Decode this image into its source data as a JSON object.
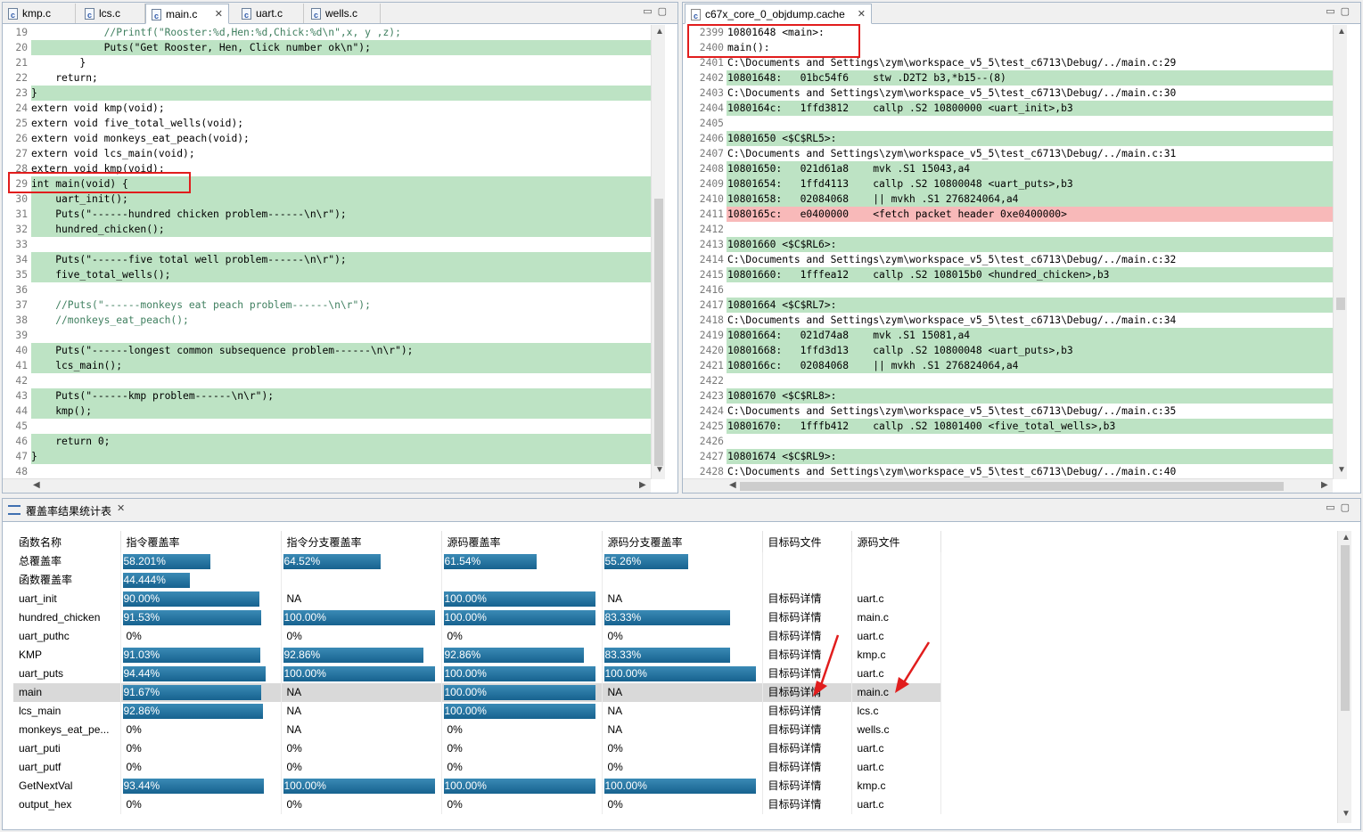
{
  "left_editor": {
    "tabs": [
      "kmp.c",
      "lcs.c",
      "main.c",
      "uart.c",
      "wells.c"
    ],
    "active_tab": "main.c",
    "lines": [
      {
        "n": "19",
        "t": "            //Printf(\"Rooster:%d,Hen:%d,Chick:%d\\n\",x, y ,z);",
        "hl": "none"
      },
      {
        "n": "20",
        "t": "            Puts(\"Get Rooster, Hen, Click number ok\\n\");",
        "hl": "green"
      },
      {
        "n": "21",
        "t": "        }",
        "hl": "none"
      },
      {
        "n": "22",
        "t": "    return;",
        "hl": "none"
      },
      {
        "n": "23",
        "t": "}",
        "hl": "green"
      },
      {
        "n": "24",
        "t": "extern void kmp(void);",
        "hl": "none"
      },
      {
        "n": "25",
        "t": "extern void five_total_wells(void);",
        "hl": "none"
      },
      {
        "n": "26",
        "t": "extern void monkeys_eat_peach(void);",
        "hl": "none"
      },
      {
        "n": "27",
        "t": "extern void lcs_main(void);",
        "hl": "none"
      },
      {
        "n": "28",
        "t": "extern void kmp(void);",
        "hl": "none"
      },
      {
        "n": "29",
        "t": "int main(void) {",
        "hl": "green"
      },
      {
        "n": "30",
        "t": "    uart_init();",
        "hl": "green"
      },
      {
        "n": "31",
        "t": "    Puts(\"------hundred chicken problem------\\n\\r\");",
        "hl": "green"
      },
      {
        "n": "32",
        "t": "    hundred_chicken();",
        "hl": "green"
      },
      {
        "n": "33",
        "t": "",
        "hl": "none"
      },
      {
        "n": "34",
        "t": "    Puts(\"------five total well problem------\\n\\r\");",
        "hl": "green"
      },
      {
        "n": "35",
        "t": "    five_total_wells();",
        "hl": "green"
      },
      {
        "n": "36",
        "t": "",
        "hl": "none"
      },
      {
        "n": "37",
        "t": "    //Puts(\"------monkeys eat peach problem------\\n\\r\");",
        "hl": "none"
      },
      {
        "n": "38",
        "t": "    //monkeys_eat_peach();",
        "hl": "none"
      },
      {
        "n": "39",
        "t": "",
        "hl": "none"
      },
      {
        "n": "40",
        "t": "    Puts(\"------longest common subsequence problem------\\n\\r\");",
        "hl": "green"
      },
      {
        "n": "41",
        "t": "    lcs_main();",
        "hl": "green"
      },
      {
        "n": "42",
        "t": "",
        "hl": "none"
      },
      {
        "n": "43",
        "t": "    Puts(\"------kmp problem------\\n\\r\");",
        "hl": "green"
      },
      {
        "n": "44",
        "t": "    kmp();",
        "hl": "green"
      },
      {
        "n": "45",
        "t": "",
        "hl": "none"
      },
      {
        "n": "46",
        "t": "    return 0;",
        "hl": "green"
      },
      {
        "n": "47",
        "t": "}",
        "hl": "green"
      },
      {
        "n": "48",
        "t": "",
        "hl": "none"
      }
    ]
  },
  "right_editor": {
    "tab": "c67x_core_0_objdump.cache",
    "lines": [
      {
        "n": "2399",
        "t": "10801648 <main>:",
        "hl": "none"
      },
      {
        "n": "2400",
        "t": "main():",
        "hl": "none"
      },
      {
        "n": "2401",
        "t": "C:\\Documents and Settings\\zym\\workspace_v5_5\\test_c6713\\Debug/../main.c:29",
        "hl": "none"
      },
      {
        "n": "2402",
        "t": "10801648:   01bc54f6    stw .D2T2 b3,*b15--(8)",
        "hl": "green"
      },
      {
        "n": "2403",
        "t": "C:\\Documents and Settings\\zym\\workspace_v5_5\\test_c6713\\Debug/../main.c:30",
        "hl": "none"
      },
      {
        "n": "2404",
        "t": "1080164c:   1ffd3812    callp .S2 10800000 <uart_init>,b3",
        "hl": "green"
      },
      {
        "n": "2405",
        "t": "",
        "hl": "none"
      },
      {
        "n": "2406",
        "t": "10801650 <$C$RL5>:",
        "hl": "green"
      },
      {
        "n": "2407",
        "t": "C:\\Documents and Settings\\zym\\workspace_v5_5\\test_c6713\\Debug/../main.c:31",
        "hl": "none"
      },
      {
        "n": "2408",
        "t": "10801650:   021d61a8    mvk .S1 15043,a4",
        "hl": "green"
      },
      {
        "n": "2409",
        "t": "10801654:   1ffd4113    callp .S2 10800048 <uart_puts>,b3",
        "hl": "green"
      },
      {
        "n": "2410",
        "t": "10801658:   02084068    || mvkh .S1 276824064,a4",
        "hl": "green"
      },
      {
        "n": "2411",
        "t": "1080165c:   e0400000    <fetch packet header 0xe0400000>",
        "hl": "red"
      },
      {
        "n": "2412",
        "t": "",
        "hl": "none"
      },
      {
        "n": "2413",
        "t": "10801660 <$C$RL6>:",
        "hl": "green"
      },
      {
        "n": "2414",
        "t": "C:\\Documents and Settings\\zym\\workspace_v5_5\\test_c6713\\Debug/../main.c:32",
        "hl": "none"
      },
      {
        "n": "2415",
        "t": "10801660:   1fffea12    callp .S2 108015b0 <hundred_chicken>,b3",
        "hl": "green"
      },
      {
        "n": "2416",
        "t": "",
        "hl": "none"
      },
      {
        "n": "2417",
        "t": "10801664 <$C$RL7>:",
        "hl": "green"
      },
      {
        "n": "2418",
        "t": "C:\\Documents and Settings\\zym\\workspace_v5_5\\test_c6713\\Debug/../main.c:34",
        "hl": "none"
      },
      {
        "n": "2419",
        "t": "10801664:   021d74a8    mvk .S1 15081,a4",
        "hl": "green"
      },
      {
        "n": "2420",
        "t": "10801668:   1ffd3d13    callp .S2 10800048 <uart_puts>,b3",
        "hl": "green"
      },
      {
        "n": "2421",
        "t": "1080166c:   02084068    || mvkh .S1 276824064,a4",
        "hl": "green"
      },
      {
        "n": "2422",
        "t": "",
        "hl": "none"
      },
      {
        "n": "2423",
        "t": "10801670 <$C$RL8>:",
        "hl": "green"
      },
      {
        "n": "2424",
        "t": "C:\\Documents and Settings\\zym\\workspace_v5_5\\test_c6713\\Debug/../main.c:35",
        "hl": "none"
      },
      {
        "n": "2425",
        "t": "10801670:   1fffb412    callp .S2 10801400 <five_total_wells>,b3",
        "hl": "green"
      },
      {
        "n": "2426",
        "t": "",
        "hl": "none"
      },
      {
        "n": "2427",
        "t": "10801674 <$C$RL9>:",
        "hl": "green"
      },
      {
        "n": "2428",
        "t": "C:\\Documents and Settings\\zym\\workspace_v5_5\\test_c6713\\Debug/../main.c:40",
        "hl": "none"
      }
    ]
  },
  "coverage": {
    "title": "覆盖率结果统计表",
    "headers": [
      "函数名称",
      "指令覆盖率",
      "指令分支覆盖率",
      "源码覆盖率",
      "源码分支覆盖率",
      "目标码文件",
      "源码文件"
    ],
    "rows": [
      {
        "name": "总覆盖率",
        "c": [
          [
            "58.201%",
            0.582
          ],
          [
            "64.52%",
            0.645
          ],
          [
            "61.54%",
            0.615
          ],
          [
            "55.26%",
            0.553
          ]
        ],
        "obj": "",
        "src": "",
        "sel": false
      },
      {
        "name": "函数覆盖率",
        "c": [
          [
            "44.444%",
            0.444
          ],
          [
            "",
            null
          ],
          [
            "",
            null
          ],
          [
            "",
            null
          ]
        ],
        "obj": "",
        "src": "",
        "sel": false
      },
      {
        "name": "uart_init",
        "c": [
          [
            "90.00%",
            0.9
          ],
          [
            "NA",
            null
          ],
          [
            "100.00%",
            1.0
          ],
          [
            "NA",
            null
          ]
        ],
        "obj": "目标码详情",
        "src": "uart.c",
        "sel": false
      },
      {
        "name": "hundred_chicken",
        "c": [
          [
            "91.53%",
            0.915
          ],
          [
            "100.00%",
            1.0
          ],
          [
            "100.00%",
            1.0
          ],
          [
            "83.33%",
            0.833
          ]
        ],
        "obj": "目标码详情",
        "src": "main.c",
        "sel": false
      },
      {
        "name": "uart_puthc",
        "c": [
          [
            "0%",
            0
          ],
          [
            "0%",
            0
          ],
          [
            "0%",
            0
          ],
          [
            "0%",
            0
          ]
        ],
        "obj": "目标码详情",
        "src": "uart.c",
        "sel": false
      },
      {
        "name": "KMP",
        "c": [
          [
            "91.03%",
            0.91
          ],
          [
            "92.86%",
            0.929
          ],
          [
            "92.86%",
            0.929
          ],
          [
            "83.33%",
            0.833
          ]
        ],
        "obj": "目标码详情",
        "src": "kmp.c",
        "sel": false
      },
      {
        "name": "uart_puts",
        "c": [
          [
            "94.44%",
            0.944
          ],
          [
            "100.00%",
            1.0
          ],
          [
            "100.00%",
            1.0
          ],
          [
            "100.00%",
            1.0
          ]
        ],
        "obj": "目标码详情",
        "src": "uart.c",
        "sel": false
      },
      {
        "name": "main",
        "c": [
          [
            "91.67%",
            0.917
          ],
          [
            "NA",
            null
          ],
          [
            "100.00%",
            1.0
          ],
          [
            "NA",
            null
          ]
        ],
        "obj": "目标码详情",
        "src": "main.c",
        "sel": true
      },
      {
        "name": "lcs_main",
        "c": [
          [
            "92.86%",
            0.929
          ],
          [
            "NA",
            null
          ],
          [
            "100.00%",
            1.0
          ],
          [
            "NA",
            null
          ]
        ],
        "obj": "目标码详情",
        "src": "lcs.c",
        "sel": false
      },
      {
        "name": "monkeys_eat_pe...",
        "c": [
          [
            "0%",
            0
          ],
          [
            "NA",
            null
          ],
          [
            "0%",
            0
          ],
          [
            "NA",
            null
          ]
        ],
        "obj": "目标码详情",
        "src": "wells.c",
        "sel": false
      },
      {
        "name": "uart_puti",
        "c": [
          [
            "0%",
            0
          ],
          [
            "0%",
            0
          ],
          [
            "0%",
            0
          ],
          [
            "0%",
            0
          ]
        ],
        "obj": "目标码详情",
        "src": "uart.c",
        "sel": false
      },
      {
        "name": "uart_putf",
        "c": [
          [
            "0%",
            0
          ],
          [
            "0%",
            0
          ],
          [
            "0%",
            0
          ],
          [
            "0%",
            0
          ]
        ],
        "obj": "目标码详情",
        "src": "uart.c",
        "sel": false
      },
      {
        "name": "GetNextVal",
        "c": [
          [
            "93.44%",
            0.934
          ],
          [
            "100.00%",
            1.0
          ],
          [
            "100.00%",
            1.0
          ],
          [
            "100.00%",
            1.0
          ]
        ],
        "obj": "目标码详情",
        "src": "kmp.c",
        "sel": false
      },
      {
        "name": "output_hex",
        "c": [
          [
            "0%",
            0
          ],
          [
            "0%",
            0
          ],
          [
            "0%",
            0
          ],
          [
            "0%",
            0
          ]
        ],
        "obj": "目标码详情",
        "src": "uart.c",
        "sel": false
      }
    ]
  },
  "colors": {
    "green_highlight": "#bde3c4",
    "red_highlight": "#f8b9b9",
    "bar": "#1f6e9c",
    "annotation": "#e11d1d"
  }
}
